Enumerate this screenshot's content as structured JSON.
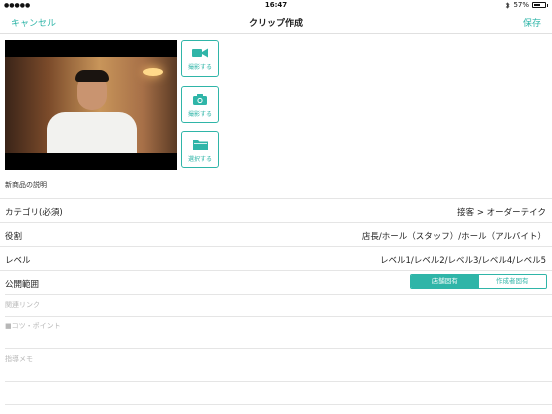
{
  "status_bar": {
    "signal": "●●●●●",
    "time": "16:47",
    "bluetooth_icon": "bluetooth-icon",
    "battery_percent": "57%",
    "battery_level": 0.57
  },
  "nav": {
    "cancel": "キャンセル",
    "title": "クリップ作成",
    "save": "保存"
  },
  "media_buttons": [
    {
      "label": "撮影する",
      "icon": "video-camera-icon"
    },
    {
      "label": "撮影する",
      "icon": "photo-camera-icon"
    },
    {
      "label": "選択する",
      "icon": "folder-icon"
    }
  ],
  "description_label": "新商品の説明",
  "rows": {
    "category": {
      "key": "カテゴリ(必須)",
      "value": "接客 > オーダーテイク"
    },
    "role": {
      "key": "役割",
      "value": "店長/ホール（スタッフ）/ホール（アルバイト）"
    },
    "level": {
      "key": "レベル",
      "value": "レベル1/レベル2/レベル3/レベル4/レベル5"
    },
    "visibility": {
      "key": "公開範囲"
    }
  },
  "visibility_segment": {
    "options": [
      "店舗固有",
      "作成者固有"
    ],
    "selected": "店舗固有"
  },
  "fields": {
    "related_link": "関連リンク",
    "tips": "■コツ・ポイント",
    "guidance_memo": "指導メモ"
  },
  "colors": {
    "accent": "#2fb5a8",
    "placeholder": "#b7b7b7",
    "divider": "#e5e5e5"
  }
}
